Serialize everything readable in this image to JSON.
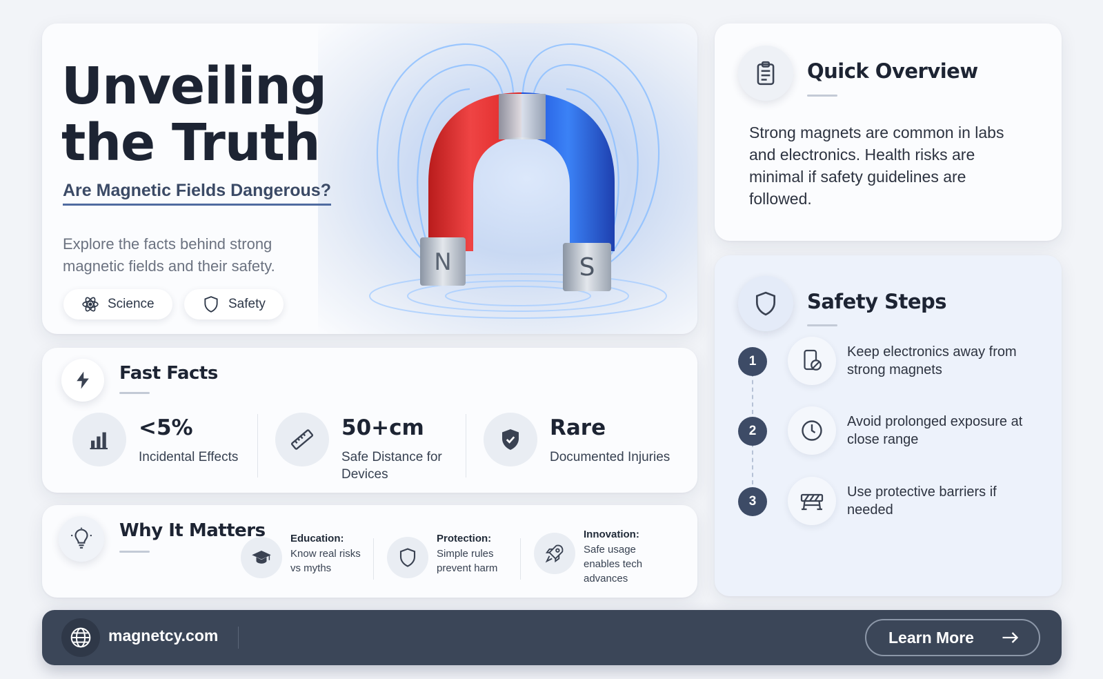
{
  "hero": {
    "title_line1": "Unveiling",
    "title_line2": "the Truth",
    "subtitle": "Are Magnetic Fields Dangerous?",
    "description": "Explore the facts behind strong magnetic fields and their safety.",
    "magnet_pole_north": "N",
    "magnet_pole_south": "S",
    "chips": [
      {
        "label": "Science",
        "icon": "atom-icon"
      },
      {
        "label": "Safety",
        "icon": "shield-icon"
      }
    ]
  },
  "overview": {
    "title": "Quick Overview",
    "icon": "clipboard-icon",
    "text": "Strong magnets are common in labs and electronics. Health risks are minimal if safety guidelines are followed."
  },
  "safety_steps": {
    "title": "Safety Steps",
    "icon": "shield-icon",
    "steps": [
      {
        "number": "1",
        "icon": "device-magnet-icon",
        "text": "Keep electronics away from strong magnets"
      },
      {
        "number": "2",
        "icon": "clock-icon",
        "text": "Avoid prolonged exposure at close range"
      },
      {
        "number": "3",
        "icon": "barrier-icon",
        "text": "Use protective barriers if needed"
      }
    ]
  },
  "fast_facts": {
    "title": "Fast Facts",
    "icon": "lightning-icon",
    "items": [
      {
        "value": "<5%",
        "label": "Incidental Effects",
        "icon": "bar-chart-icon"
      },
      {
        "value": "50+cm",
        "label": "Safe Distance for Devices",
        "icon": "ruler-icon"
      },
      {
        "value": "Rare",
        "label": "Documented Injuries",
        "icon": "shield-check-icon"
      }
    ]
  },
  "why_it_matters": {
    "title": "Why It Matters",
    "icon": "lightbulb-icon",
    "items": [
      {
        "heading": "Education:",
        "text": "Know real risks vs myths",
        "icon": "graduation-cap-icon"
      },
      {
        "heading": "Protection:",
        "text": "Simple rules prevent harm",
        "icon": "shield-icon"
      },
      {
        "heading": "Innovation:",
        "text": "Safe usage enables tech advances",
        "icon": "rocket-icon"
      }
    ]
  },
  "footer": {
    "site": "magnetcy.com",
    "button_label": "Learn More",
    "icon": "globe-icon"
  },
  "colors": {
    "navy": "#3b4658",
    "magnet_red": "#e63636",
    "magnet_blue": "#2f6fd8",
    "field_glow": "#7fb2ff"
  }
}
